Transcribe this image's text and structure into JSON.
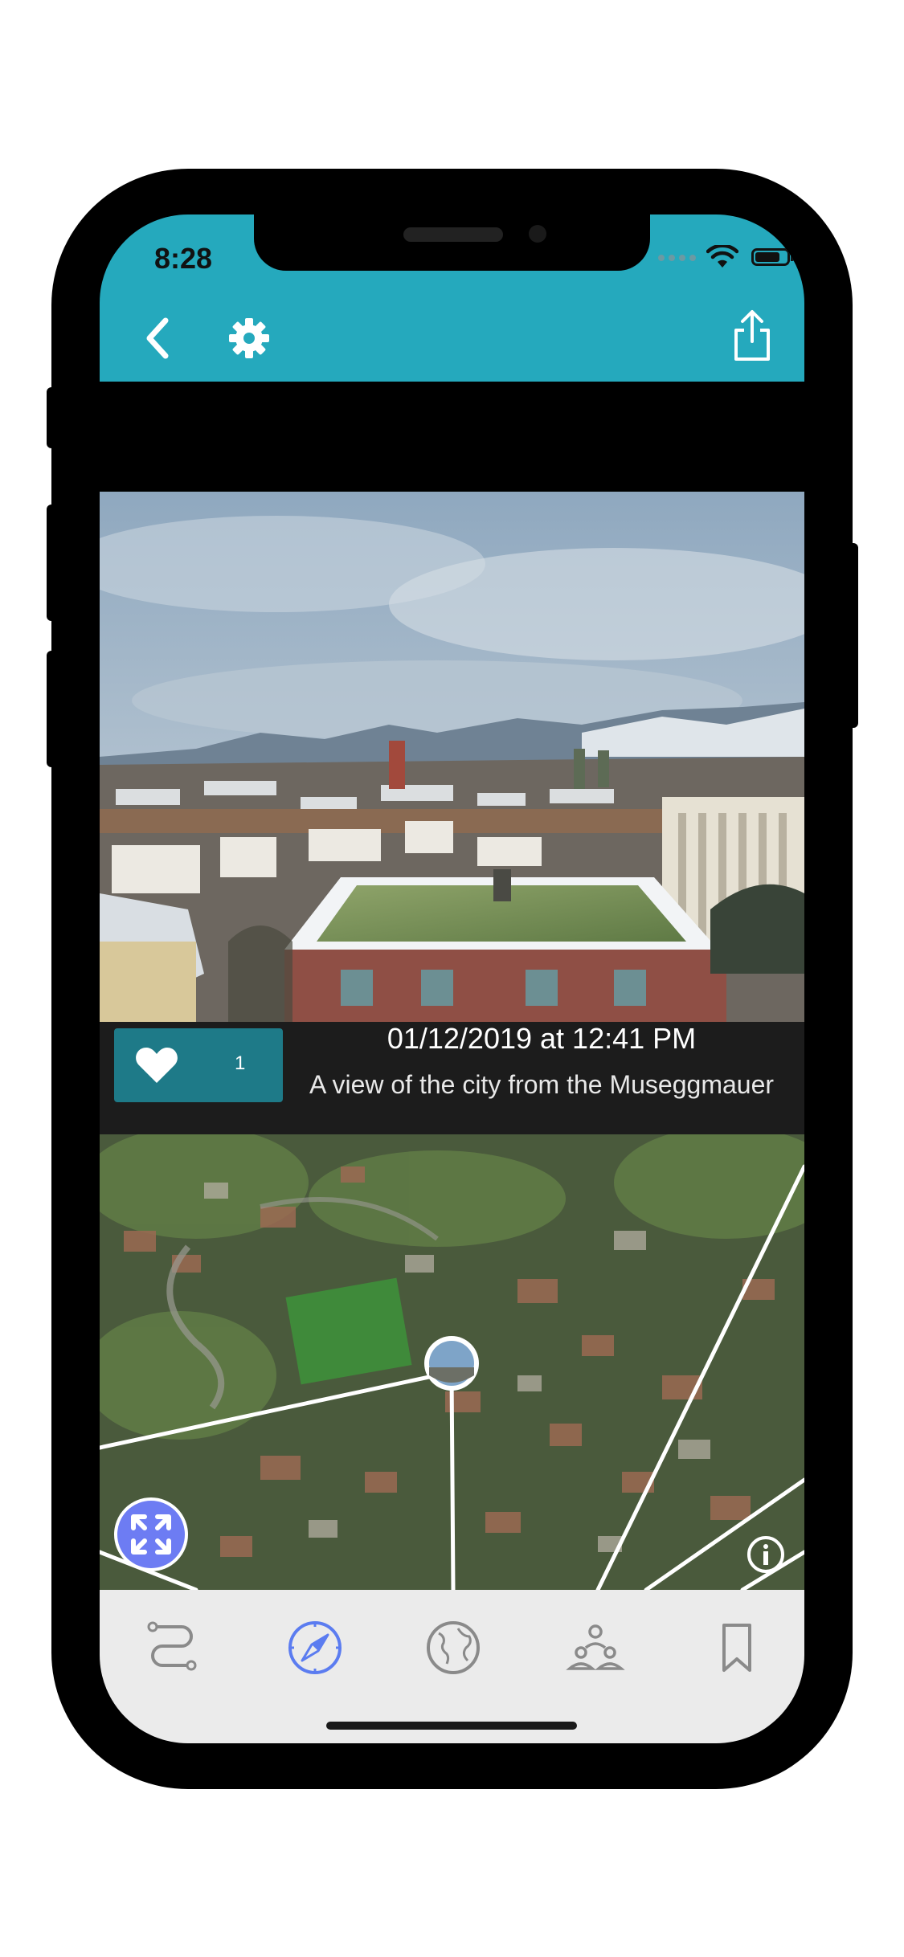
{
  "status_bar": {
    "time": "8:28"
  },
  "header": {
    "back_icon": "chevron-left-icon",
    "settings_icon": "gear-icon",
    "share_icon": "share-icon"
  },
  "photo_card": {
    "date": "01/12/2019 at 12:41 PM",
    "description": "A view of the city from the Museggmauer",
    "like_count": "1"
  },
  "map": {
    "expand_icon": "expand-arrows-icon",
    "info_icon": "info-icon"
  },
  "tab_bar": {
    "items": [
      {
        "icon": "route-icon",
        "active": false
      },
      {
        "icon": "compass-icon",
        "active": true
      },
      {
        "icon": "globe-icon",
        "active": false
      },
      {
        "icon": "people-icon",
        "active": false
      },
      {
        "icon": "bookmark-icon",
        "active": false
      }
    ]
  },
  "colors": {
    "header": "#25a9bd",
    "like_button": "#1e7a88",
    "active_tab": "#5b7cf0",
    "inactive_tab": "#8a8a8a",
    "expand_button": "#6d7cf3"
  }
}
